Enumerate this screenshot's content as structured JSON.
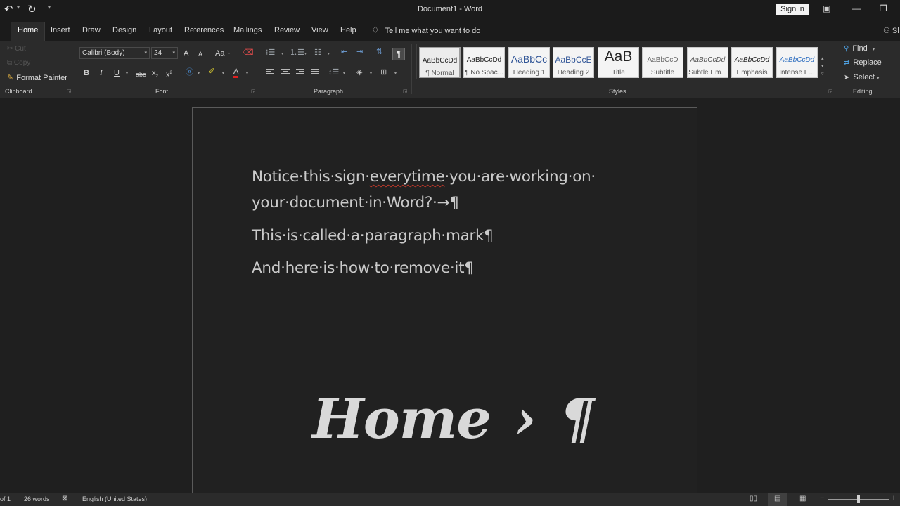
{
  "titlebar": {
    "undo_icon": "undo-icon",
    "redo_icon": "redo-icon",
    "title": "Document1  -  Word",
    "sign_in": "Sign in"
  },
  "tabs": {
    "items": [
      "Home",
      "Insert",
      "Draw",
      "Design",
      "Layout",
      "References",
      "Mailings",
      "Review",
      "View",
      "Help"
    ],
    "active": "Home",
    "tell_me": "Tell me what you want to do",
    "share_label": "Sl"
  },
  "ribbon": {
    "clipboard": {
      "cut": "Cut",
      "copy": "Copy",
      "format_painter": "Format Painter",
      "label": "Clipboard"
    },
    "font": {
      "name": "Calibri (Body)",
      "size": "24",
      "grow": "A",
      "shrink": "A",
      "change_case": "Aa",
      "bold": "B",
      "italic": "I",
      "underline": "U",
      "strike": "abc",
      "subscript": "x",
      "superscript": "x",
      "font_color": "A",
      "label": "Font"
    },
    "paragraph": {
      "show_marks": "¶",
      "label": "Paragraph"
    },
    "styles": {
      "items": [
        {
          "sample": "AaBbCcDd",
          "name": "¶ Normal"
        },
        {
          "sample": "AaBbCcDd",
          "name": "¶ No Spac..."
        },
        {
          "sample": "AaBbCc",
          "name": "Heading 1"
        },
        {
          "sample": "AaBbCcE",
          "name": "Heading 2"
        },
        {
          "sample": "AaB",
          "name": "Title"
        },
        {
          "sample": "AaBbCcD",
          "name": "Subtitle"
        },
        {
          "sample": "AaBbCcDd",
          "name": "Subtle Em..."
        },
        {
          "sample": "AaBbCcDd",
          "name": "Emphasis"
        },
        {
          "sample": "AaBbCcDd",
          "name": "Intense E..."
        }
      ],
      "label": "Styles"
    },
    "editing": {
      "find": "Find",
      "replace": "Replace",
      "select": "Select",
      "label": "Editing"
    }
  },
  "document": {
    "line1": "Notice·this·sign·",
    "line1_misspelled": "everytime",
    "line1_rest": "·you·are·working·on·",
    "line2": "your·document·in·Word?·→¶",
    "line3": "This·is·called·a·paragraph·mark¶",
    "line4": "And·here·is·how·to·remove·it¶",
    "overlay_home": "Home",
    "overlay_arrow": "›",
    "overlay_mark": "¶"
  },
  "statusbar": {
    "page": "of 1",
    "words": "26 words",
    "language": "English (United States)"
  },
  "colors": {
    "background": "#1f1f1f",
    "ribbon": "#2b2b2b",
    "text": "#cacaca",
    "spell_error": "#c0392b"
  }
}
